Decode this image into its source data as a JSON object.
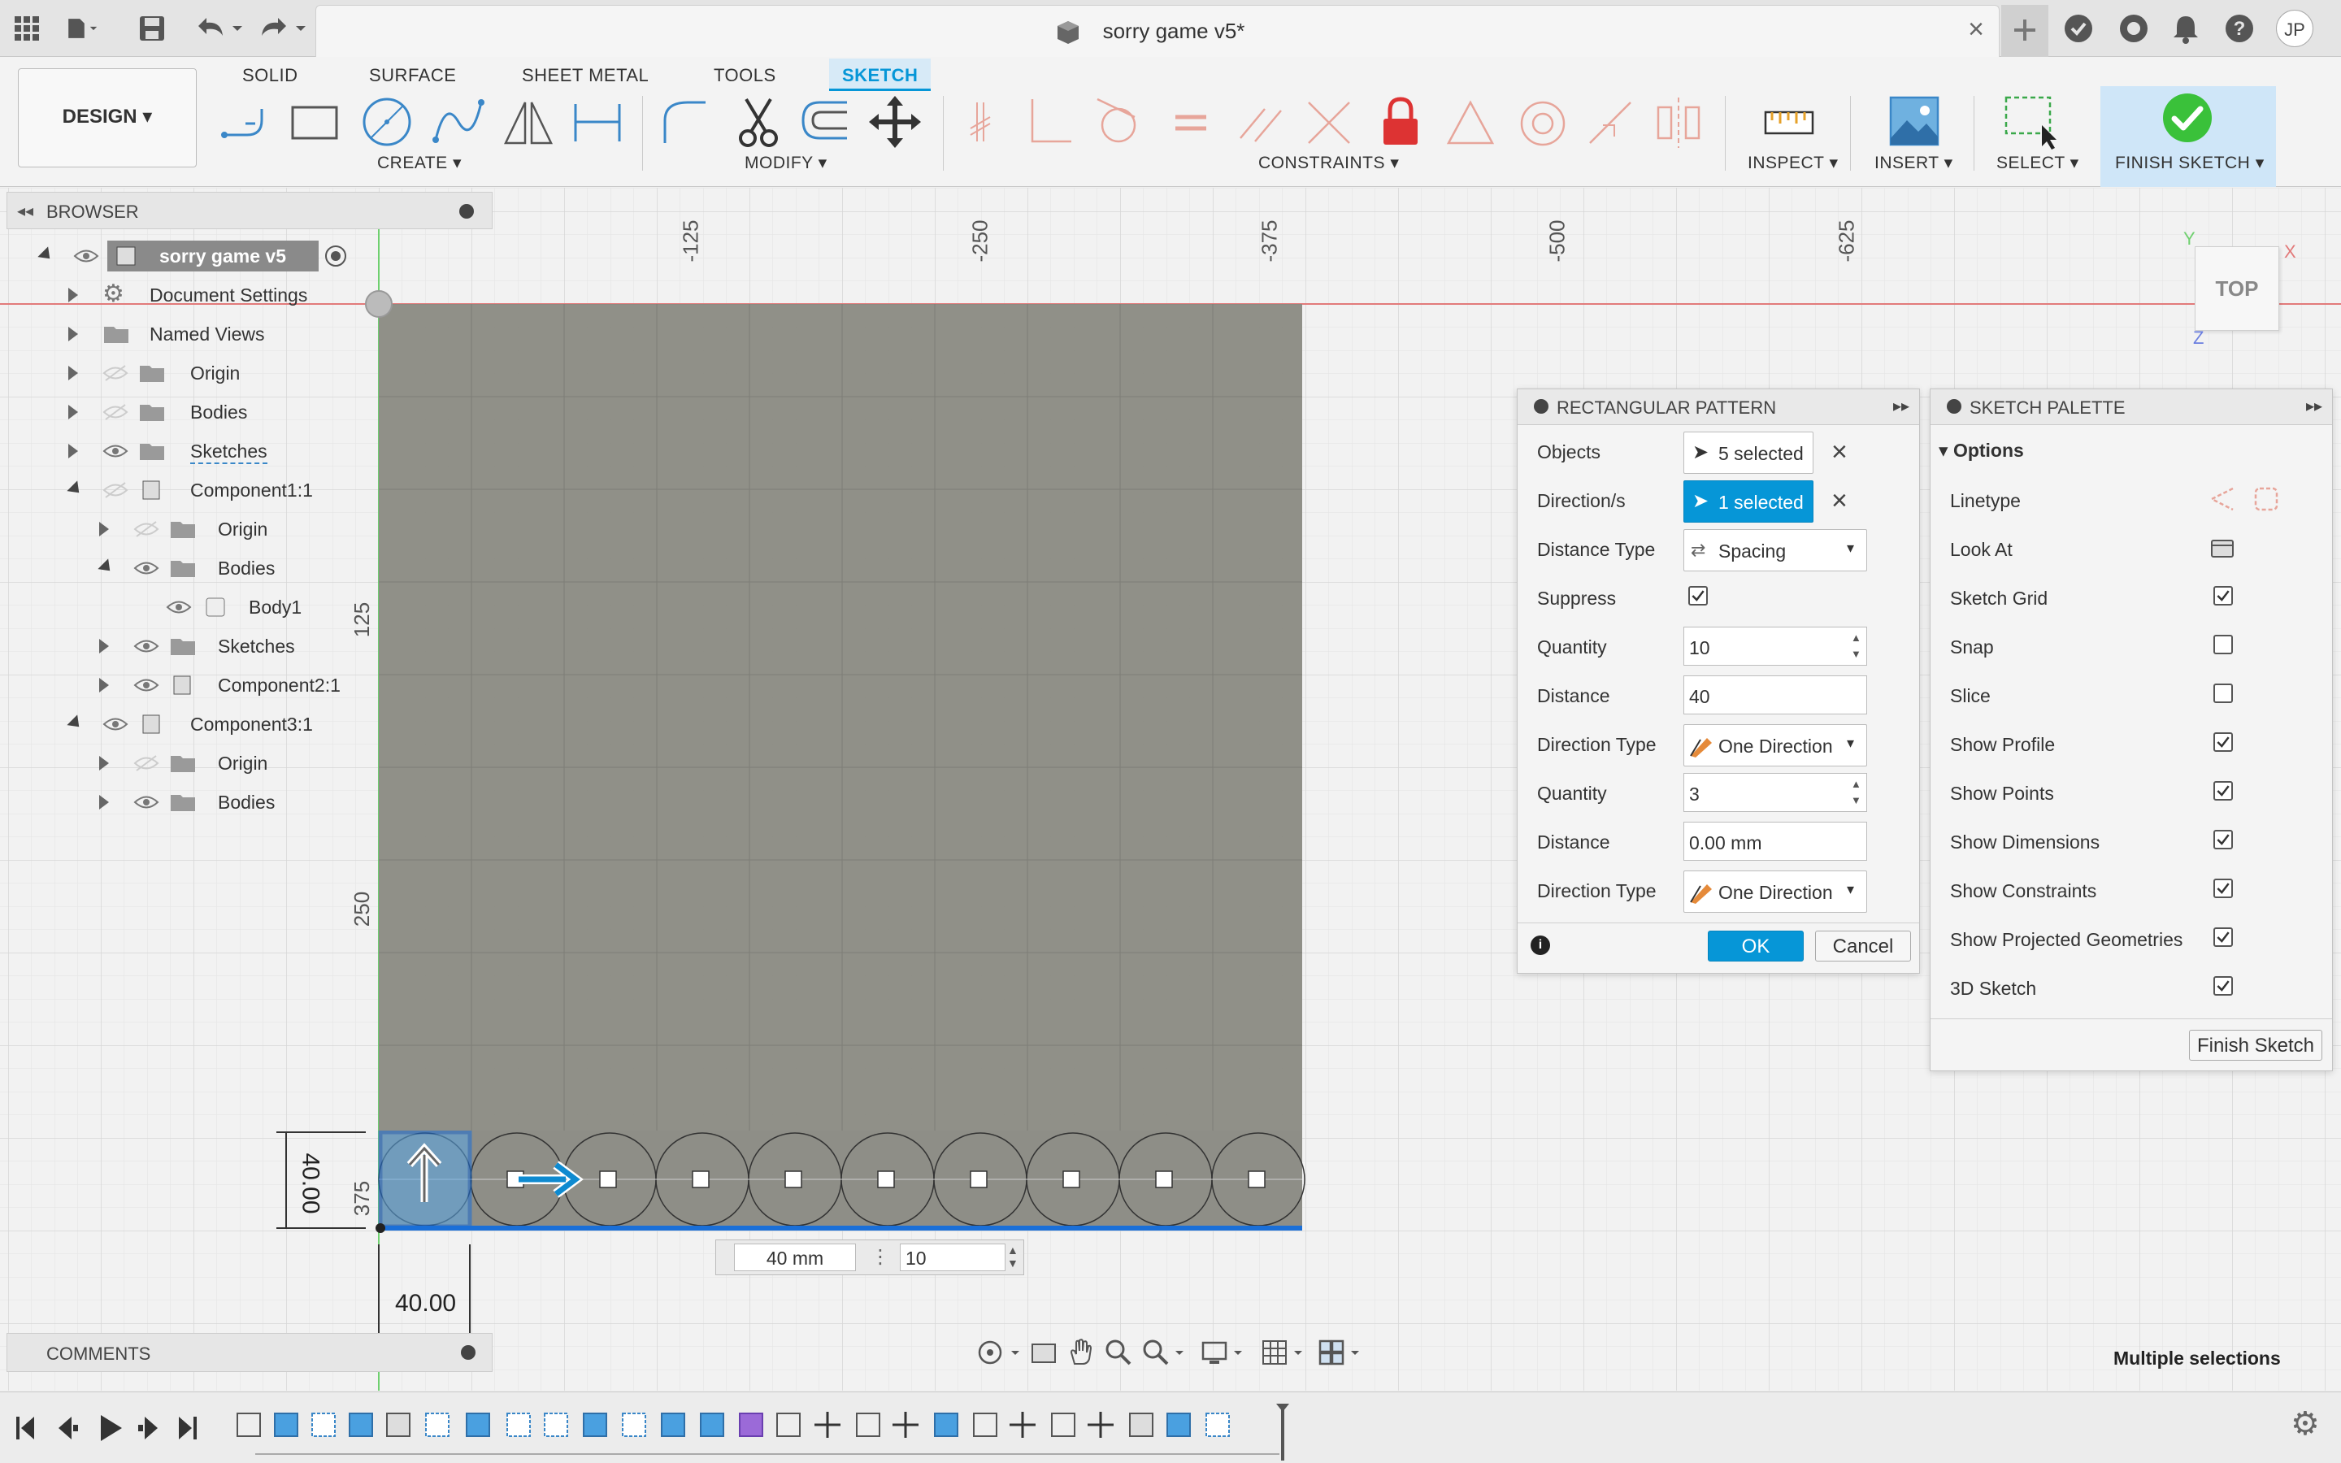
{
  "titlebar": {
    "document_title": "sorry game v5*",
    "user_initials": "JP"
  },
  "ribbon": {
    "design_label": "DESIGN",
    "tabs": [
      {
        "label": "SOLID"
      },
      {
        "label": "SURFACE"
      },
      {
        "label": "SHEET METAL"
      },
      {
        "label": "TOOLS"
      },
      {
        "label": "SKETCH"
      }
    ],
    "groups": {
      "create": "CREATE",
      "modify": "MODIFY",
      "constraints": "CONSTRAINTS",
      "inspect": "INSPECT",
      "insert": "INSERT",
      "select": "SELECT",
      "finish": "FINISH SKETCH"
    },
    "accent": "#0696d7"
  },
  "browser": {
    "title": "BROWSER",
    "root": "sorry game v5",
    "items": [
      {
        "label": "Document Settings"
      },
      {
        "label": "Named Views"
      },
      {
        "label": "Origin"
      },
      {
        "label": "Bodies"
      },
      {
        "label": "Sketches"
      },
      {
        "label": "Component1:1"
      },
      {
        "label": "Origin"
      },
      {
        "label": "Bodies"
      },
      {
        "label": "Body1"
      },
      {
        "label": "Sketches"
      },
      {
        "label": "Component2:1"
      },
      {
        "label": "Component3:1"
      },
      {
        "label": "Origin"
      },
      {
        "label": "Bodies"
      }
    ]
  },
  "comments": {
    "title": "COMMENTS"
  },
  "viewport": {
    "ruler_top": [
      "-125",
      "-250",
      "-375",
      "-500",
      "-625"
    ],
    "ruler_left": [
      "125",
      "250",
      "375"
    ],
    "dim_vertical": "40.00",
    "dim_horizontal": "40.00",
    "viewcube": "TOP",
    "axis_x": "X",
    "axis_y": "Y",
    "axis_z": "Z",
    "inline_distance": "40 mm",
    "inline_quantity": "10"
  },
  "rect_pattern": {
    "title": "RECTANGULAR PATTERN",
    "rows": {
      "objects_label": "Objects",
      "objects_value": "5 selected",
      "directions_label": "Direction/s",
      "directions_value": "1 selected",
      "distance_type_label": "Distance Type",
      "distance_type_value": "Spacing",
      "suppress_label": "Suppress",
      "quantity1_label": "Quantity",
      "quantity1_value": "10",
      "distance1_label": "Distance",
      "distance1_value": "40",
      "direction_type1_label": "Direction Type",
      "direction_type1_value": "One Direction",
      "quantity2_label": "Quantity",
      "quantity2_value": "3",
      "distance2_label": "Distance",
      "distance2_value": "0.00 mm",
      "direction_type2_label": "Direction Type",
      "direction_type2_value": "One Direction"
    },
    "ok": "OK",
    "cancel": "Cancel"
  },
  "sketch_palette": {
    "title": "SKETCH PALETTE",
    "section": "Options",
    "options": [
      {
        "label": "Linetype"
      },
      {
        "label": "Look At"
      },
      {
        "label": "Sketch Grid",
        "checked": true
      },
      {
        "label": "Snap",
        "checked": false
      },
      {
        "label": "Slice",
        "checked": false
      },
      {
        "label": "Show Profile",
        "checked": true
      },
      {
        "label": "Show Points",
        "checked": true
      },
      {
        "label": "Show Dimensions",
        "checked": true
      },
      {
        "label": "Show Constraints",
        "checked": true
      },
      {
        "label": "Show Projected Geometries",
        "checked": true
      },
      {
        "label": "3D Sketch",
        "checked": true
      }
    ],
    "finish_button": "Finish Sketch"
  },
  "status": {
    "text": "Multiple selections"
  }
}
